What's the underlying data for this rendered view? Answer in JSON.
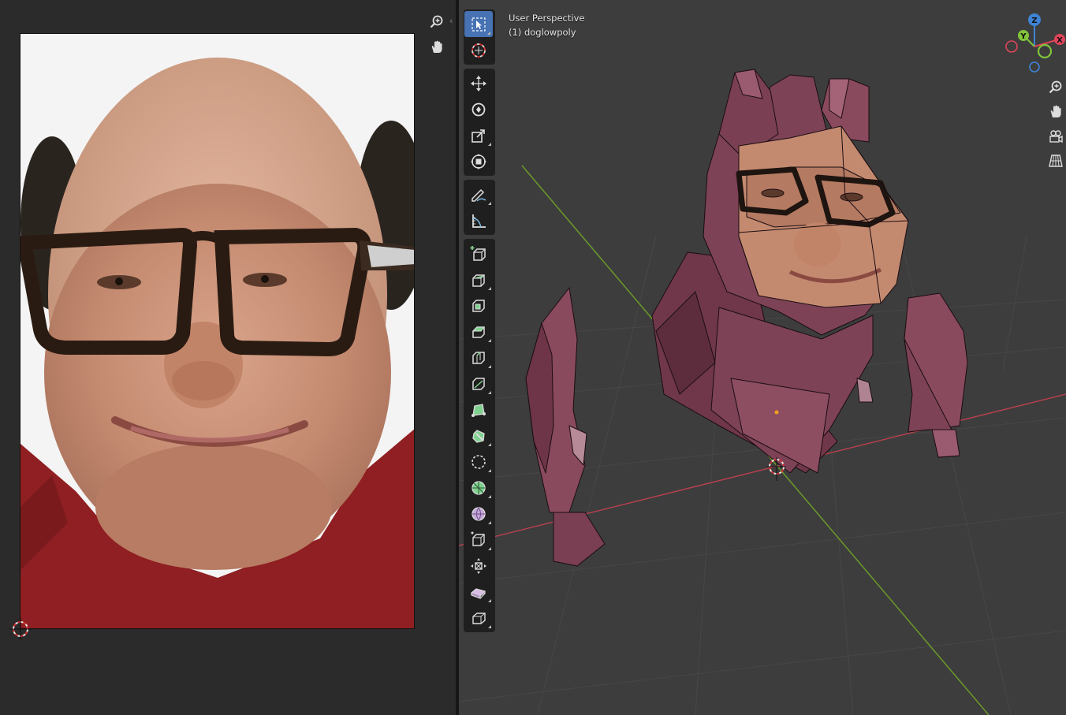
{
  "viewport": {
    "mode_label": "User Perspective",
    "object_label": "(1) doglowpoly"
  },
  "gizmo": {
    "axis_x": "X",
    "axis_y": "Y",
    "axis_z": "Z"
  },
  "colors": {
    "accent": "#4772b3",
    "x_axis": "#e0445a",
    "y_axis": "#82c43b",
    "z_axis": "#3f83d4",
    "mesh": "#7a3f52"
  },
  "uv_editor": {
    "tools": [
      "zoom-icon",
      "hand-pan-icon"
    ]
  },
  "toolbar": {
    "tools": [
      "select-box-icon",
      "cursor-icon",
      "move-icon",
      "rotate-icon",
      "scale-icon",
      "transform-icon",
      "annotate-icon",
      "measure-icon",
      "add-cube-icon",
      "extrude-region-icon",
      "inset-faces-icon",
      "bevel-icon",
      "loop-cut-icon",
      "knife-icon",
      "poly-build-icon",
      "spin-icon",
      "smooth-vertices-icon",
      "edge-slide-icon",
      "shrink-fatten-icon",
      "shear-icon",
      "rip-region-icon",
      "to-sphere-icon"
    ]
  },
  "viewport_nav": {
    "tools": [
      "zoom-icon",
      "hand-pan-icon",
      "camera-view-icon",
      "ortho-grid-icon"
    ]
  }
}
